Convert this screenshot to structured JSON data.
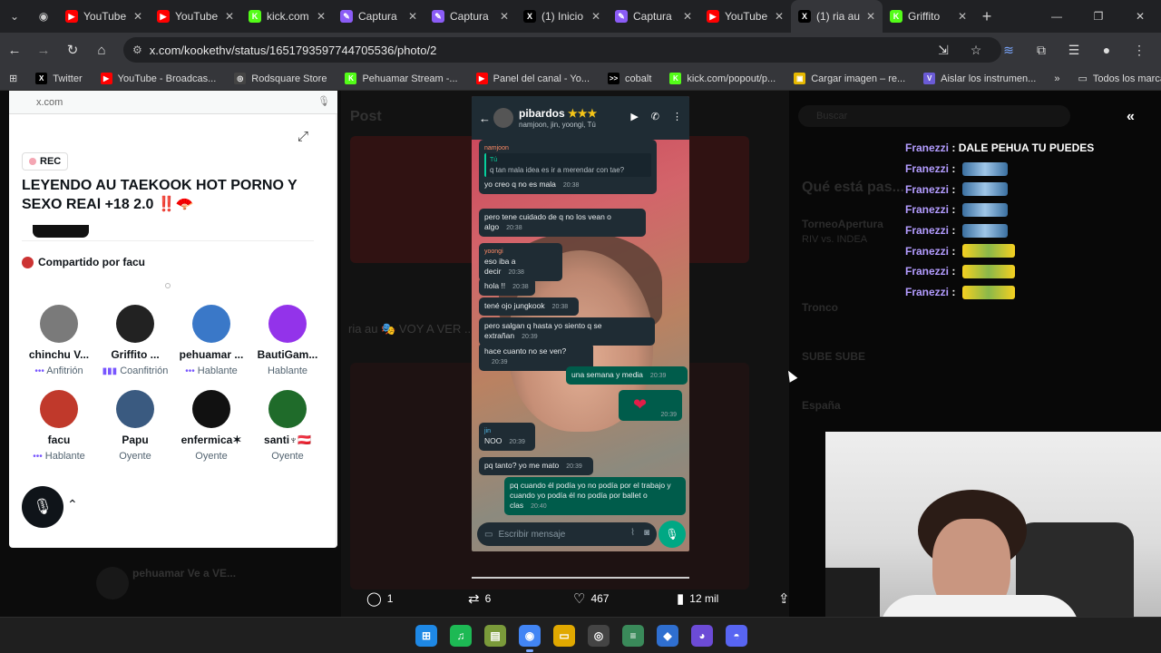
{
  "tabs": [
    {
      "title": "YouTube",
      "color": "#ff0000",
      "glyph": "▶",
      "active": false
    },
    {
      "title": "YouTube",
      "color": "#ff0000",
      "glyph": "▶",
      "active": false
    },
    {
      "title": "kick.com",
      "color": "#53fc18",
      "glyph": "K",
      "active": false
    },
    {
      "title": "Captura",
      "color": "#8b5cf6",
      "glyph": "✎",
      "active": false
    },
    {
      "title": "Captura",
      "color": "#8b5cf6",
      "glyph": "✎",
      "active": false
    },
    {
      "title": "(1) Inicio",
      "color": "#000000",
      "glyph": "X",
      "active": false
    },
    {
      "title": "Captura",
      "color": "#8b5cf6",
      "glyph": "✎",
      "active": false
    },
    {
      "title": "YouTube",
      "color": "#ff0000",
      "glyph": "▶",
      "active": false
    },
    {
      "title": "(1) ria au",
      "color": "#000000",
      "glyph": "X",
      "active": true
    },
    {
      "title": "Griffito",
      "color": "#53fc18",
      "glyph": "K",
      "active": false
    }
  ],
  "address": {
    "url": "x.com/kookethv/status/1651793597744705536/photo/2"
  },
  "bookmarks": [
    {
      "label": "Twitter",
      "color": "#000000",
      "glyph": "X"
    },
    {
      "label": "YouTube - Broadcas...",
      "color": "#ff0000",
      "glyph": "▶"
    },
    {
      "label": "Rodsquare Store",
      "color": "#444444",
      "glyph": "◎"
    },
    {
      "label": "Pehuamar Stream -...",
      "color": "#53fc18",
      "glyph": "K"
    },
    {
      "label": "Panel del canal - Yo...",
      "color": "#ff0000",
      "glyph": "▶"
    },
    {
      "label": "cobalt",
      "color": "#000000",
      "glyph": ">>"
    },
    {
      "label": "kick.com/popout/p...",
      "color": "#53fc18",
      "glyph": "K"
    },
    {
      "label": "Cargar imagen – re...",
      "color": "#e6b800",
      "glyph": "▣"
    },
    {
      "label": "Aislar los instrumen...",
      "color": "#6b5bd6",
      "glyph": "V"
    }
  ],
  "bookmarks_all": "Todos los marcadores",
  "spaces": {
    "domain": "x.com",
    "rec": "REC",
    "title": "LEYENDO AU TAEKOOK HOT PORNO Y SEXO REAl +18 2.0",
    "title_emoji": "‼️🪭",
    "shared_by": "Compartido por facu",
    "participants": [
      {
        "name": "chinchu V...",
        "role": "Anfitrión",
        "role_icon": "•••",
        "color": "#7a7a7a"
      },
      {
        "name": "Griffito ...",
        "role": "Coanfitrión",
        "role_icon": "▮▮▮",
        "color": "#222222"
      },
      {
        "name": "pehuamar ...",
        "role": "Hablante",
        "role_icon": "•••",
        "color": "#3a78c8"
      },
      {
        "name": "BautiGam...",
        "role": "Hablante",
        "role_icon": "",
        "color": "#9333ea"
      },
      {
        "name": "facu",
        "role": "Hablante",
        "role_icon": "•••",
        "color": "#c0392b"
      },
      {
        "name": "Papu",
        "role": "Oyente",
        "role_icon": "",
        "color": "#3a5a80"
      },
      {
        "name": "enfermica✶",
        "role": "Oyente",
        "role_icon": "",
        "color": "#111111"
      },
      {
        "name": "santi♆🇦🇹",
        "role": "Oyente",
        "role_icon": "",
        "color": "#1f6b2a"
      }
    ]
  },
  "whatsapp": {
    "group_name": "pibardos",
    "group_stars": "★★★",
    "members": "namjoon, jin, yoongi, Tú",
    "messages": [
      {
        "sender": "namjoon",
        "quote_name": "Tú",
        "quote_text": "q tan mala idea es ir a merendar con tae?",
        "text": "yo creo q no es mala",
        "time": "20:38",
        "out": false
      },
      {
        "sender": "",
        "text": "pero tene cuidado de q no los vean o algo",
        "time": "20:38",
        "out": false
      },
      {
        "sender": "yoongi",
        "text": "eso iba a decir",
        "time": "20:38",
        "out": false
      },
      {
        "sender": "",
        "text": "hola !!",
        "time": "20:38",
        "out": false
      },
      {
        "sender": "",
        "text": "tené ojo jungkook",
        "time": "20:38",
        "out": false
      },
      {
        "sender": "",
        "text": "pero salgan q hasta yo siento q se extrañan",
        "time": "20:39",
        "out": false
      },
      {
        "sender": "",
        "text": "hace cuanto no se ven?",
        "time": "20:39",
        "out": false
      },
      {
        "sender": "",
        "text": "una semana y media",
        "time": "20:39",
        "out": true
      },
      {
        "sender": "jin",
        "text": "NOO",
        "time": "20:39",
        "out": false
      },
      {
        "sender": "",
        "text": "pq tanto? yo me mato",
        "time": "20:39",
        "out": false
      },
      {
        "sender": "",
        "text": "pq cuando él podía yo no podía por el trabajo y cuando yo podía él no podía por ballet o clas",
        "time": "20:40",
        "out": true
      }
    ],
    "heart_time": "20:39",
    "input_placeholder": "Escribir mensaje"
  },
  "post_actions": {
    "replies": "1",
    "reposts": "6",
    "likes": "467",
    "views": "12 mil"
  },
  "chat": {
    "lines": [
      {
        "user": "Franezzi",
        "text": "DALE PEHUA TU PUEDES",
        "emote": ""
      },
      {
        "user": "Franezzi",
        "text": "",
        "emote": "car"
      },
      {
        "user": "Franezzi",
        "text": "",
        "emote": "car"
      },
      {
        "user": "Franezzi",
        "text": "",
        "emote": "car"
      },
      {
        "user": "Franezzi",
        "text": "",
        "emote": "car"
      },
      {
        "user": "Franezzi",
        "text": "",
        "emote": "smile"
      },
      {
        "user": "Franezzi",
        "text": "",
        "emote": "smile"
      },
      {
        "user": "Franezzi",
        "text": "",
        "emote": "smile"
      }
    ]
  },
  "background": {
    "post_label": "Post",
    "search_label": "Buscar",
    "whats_happening": "Qué está pas...",
    "trend1": "TorneoApertura",
    "trend1_sub": "RIV vs. INDEA",
    "trend2": "Tronco",
    "trend3": "SUBE SUBE",
    "trend4": "España",
    "reply_user": "pehuamar Ve a VE..."
  },
  "taskbar": [
    {
      "name": "windows-start",
      "color": "#1e88e5",
      "glyph": "⊞"
    },
    {
      "name": "spotify",
      "color": "#1db954",
      "glyph": "♫"
    },
    {
      "name": "app-green",
      "color": "#7a9a3a",
      "glyph": "▤"
    },
    {
      "name": "chrome",
      "color": "#4285f4",
      "glyph": "◉"
    },
    {
      "name": "file-explorer",
      "color": "#e0a800",
      "glyph": "▭"
    },
    {
      "name": "obs",
      "color": "#444444",
      "glyph": "◎"
    },
    {
      "name": "app-stack",
      "color": "#3a8a5a",
      "glyph": "≡"
    },
    {
      "name": "app-diamond",
      "color": "#2f6fd0",
      "glyph": "◆"
    },
    {
      "name": "app-chat",
      "color": "#6c4bd6",
      "glyph": "◕"
    },
    {
      "name": "discord",
      "color": "#5865f2",
      "glyph": "◓"
    }
  ]
}
